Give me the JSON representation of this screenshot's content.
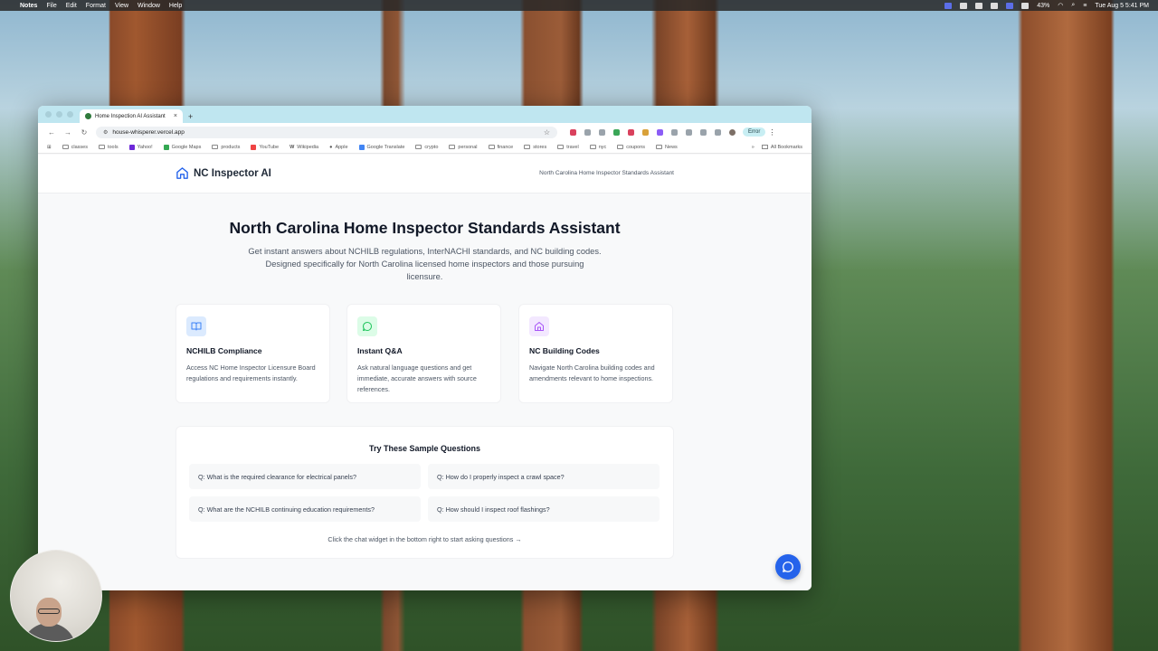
{
  "menubar": {
    "app": "Notes",
    "items": [
      "File",
      "Edit",
      "Format",
      "View",
      "Window",
      "Help"
    ],
    "battery": "43%",
    "clock": "Tue Aug 5  5:41 PM"
  },
  "browser": {
    "tab_title": "Home Inspection AI Assistant",
    "url": "house-whisperer.vercel.app",
    "error_label": "Error",
    "bookmarks": [
      "classes",
      "tools",
      "Yahoo!",
      "Google Maps",
      "products",
      "YouTube",
      "Wikipedia",
      "Apple",
      "Google Translate",
      "crypto",
      "personal",
      "finance",
      "stores",
      "travel",
      "nyc",
      "coupons",
      "News"
    ],
    "all_bookmarks": "All Bookmarks"
  },
  "site": {
    "brand": "NC Inspector AI",
    "tagline": "North Carolina Home Inspector Standards Assistant",
    "hero_title": "North Carolina Home Inspector Standards Assistant",
    "hero_subtitle": "Get instant answers about NCHILB regulations, InterNACHI standards, and NC building codes. Designed specifically for North Carolina licensed home inspectors and those pursuing licensure.",
    "cards": [
      {
        "title": "NCHILB Compliance",
        "text": "Access NC Home Inspector Licensure Board regulations and requirements instantly.",
        "icon": "book-icon",
        "color": "#3b82f6"
      },
      {
        "title": "Instant Q&A",
        "text": "Ask natural language questions and get immediate, accurate answers with source references.",
        "icon": "chat-bubble-icon",
        "color": "#22c55e"
      },
      {
        "title": "NC Building Codes",
        "text": "Navigate North Carolina building codes and amendments relevant to home inspections.",
        "icon": "house-icon",
        "color": "#a855f7"
      }
    ],
    "samples_title": "Try These Sample Questions",
    "questions": [
      "Q: What is the required clearance for electrical panels?",
      "Q: How do I properly inspect a crawl space?",
      "Q: What are the NCHILB continuing education requirements?",
      "Q: How should I inspect roof flashings?"
    ],
    "hint": "Click the chat widget in the bottom right to start asking questions →"
  }
}
